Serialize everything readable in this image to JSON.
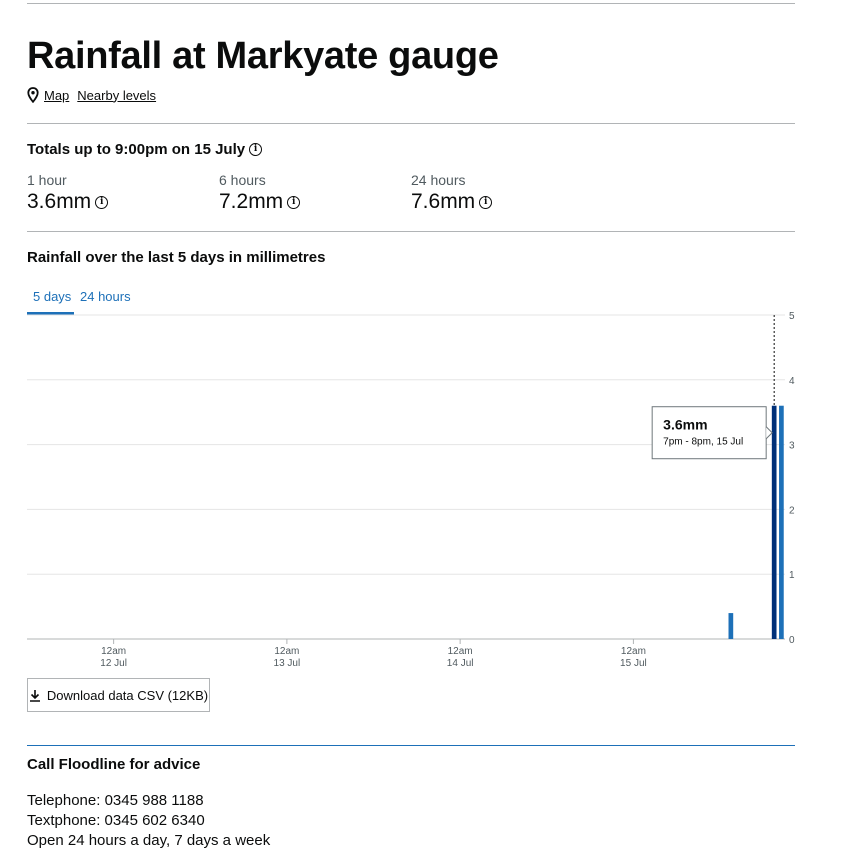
{
  "page": {
    "title": "Rainfall at Markyate gauge",
    "links": {
      "map": "Map",
      "nearby": "Nearby levels"
    }
  },
  "totals": {
    "heading": "Totals up to 9:00pm on 15 July",
    "items": [
      {
        "label": "1 hour",
        "value": "3.6mm"
      },
      {
        "label": "6 hours",
        "value": "7.2mm"
      },
      {
        "label": "24 hours",
        "value": "7.6mm"
      }
    ]
  },
  "chart_section": {
    "heading": "Rainfall over the last 5 days in millimetres",
    "tabs": [
      "5 days",
      "24 hours"
    ],
    "active_tab": "5 days"
  },
  "chart_data": {
    "type": "bar",
    "x_start": "2025-07-11T12:00",
    "x_end": "2025-07-15T21:00",
    "x_ticks": [
      {
        "at": "2025-07-12T00:00",
        "line1": "12am",
        "line2": "12 Jul"
      },
      {
        "at": "2025-07-13T00:00",
        "line1": "12am",
        "line2": "13 Jul"
      },
      {
        "at": "2025-07-14T00:00",
        "line1": "12am",
        "line2": "14 Jul"
      },
      {
        "at": "2025-07-15T00:00",
        "line1": "12am",
        "line2": "15 Jul"
      }
    ],
    "y_ticks": [
      0,
      1,
      2,
      3,
      4,
      5
    ],
    "ylim": [
      0,
      5
    ],
    "grid": true,
    "bars": [
      {
        "start": "2025-07-15T13:00",
        "value": 0.4
      },
      {
        "start": "2025-07-15T19:00",
        "value": 3.6
      },
      {
        "start": "2025-07-15T20:00",
        "value": 3.6
      }
    ],
    "tooltip": {
      "value": "3.6mm",
      "time": "7pm - 8pm, 15 Jul"
    }
  },
  "download": {
    "label": "Download data CSV (12KB)"
  },
  "floodline": {
    "heading": "Call Floodline for advice",
    "telephone": "Telephone: 0345 988 1188",
    "textphone": "Textphone: 0345 602 6340",
    "hours": "Open 24 hours a day, 7 days a week"
  },
  "colors": {
    "bar": "#1d70b8",
    "bar_selected": "#003078",
    "link": "#1d70b8",
    "text": "#0b0c0c",
    "secondary": "#505a5f",
    "grid": "#e5e5e5"
  }
}
